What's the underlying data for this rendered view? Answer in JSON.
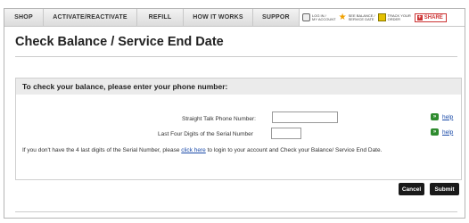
{
  "nav": {
    "tabs": [
      {
        "label": "SHOP"
      },
      {
        "label": "ACTIVATE/REACTIVATE"
      },
      {
        "label": "REFILL"
      },
      {
        "label": "HOW IT WORKS"
      },
      {
        "label": "SUPPOR"
      }
    ],
    "utilities": [
      {
        "line1": "LOG IN /",
        "line2": "MY ACCOUNT",
        "icon": "lock-icon"
      },
      {
        "line1": "SEE BALANCE /",
        "line2": "SERVICE DATE",
        "icon": "star-icon"
      },
      {
        "line1": "TRACK YOUR",
        "line2": "ORDER",
        "icon": "document-icon"
      }
    ],
    "share_label": "SHARE"
  },
  "page": {
    "title": "Check Balance / Service End Date"
  },
  "panel": {
    "heading": "To check your balance, please enter your phone number:",
    "phone_label": "Straight Talk Phone Number:",
    "phone_value": "",
    "serial_label": "Last Four Digits of the Serial Number",
    "serial_value": "",
    "help_label": "help",
    "info_before": "If you don't have the 4 last digits of the  Serial Number,  please ",
    "info_link": "click here",
    "info_after": " to login to your account and Check your Balance/ Service End Date."
  },
  "actions": {
    "cancel_label": "Cancel",
    "submit_label": "Submit"
  },
  "colors": {
    "accent_link": "#1a4aa8",
    "help_arrow": "#2e8b2e",
    "share_red": "#cc3333",
    "button_dark": "#1a1a1a"
  }
}
